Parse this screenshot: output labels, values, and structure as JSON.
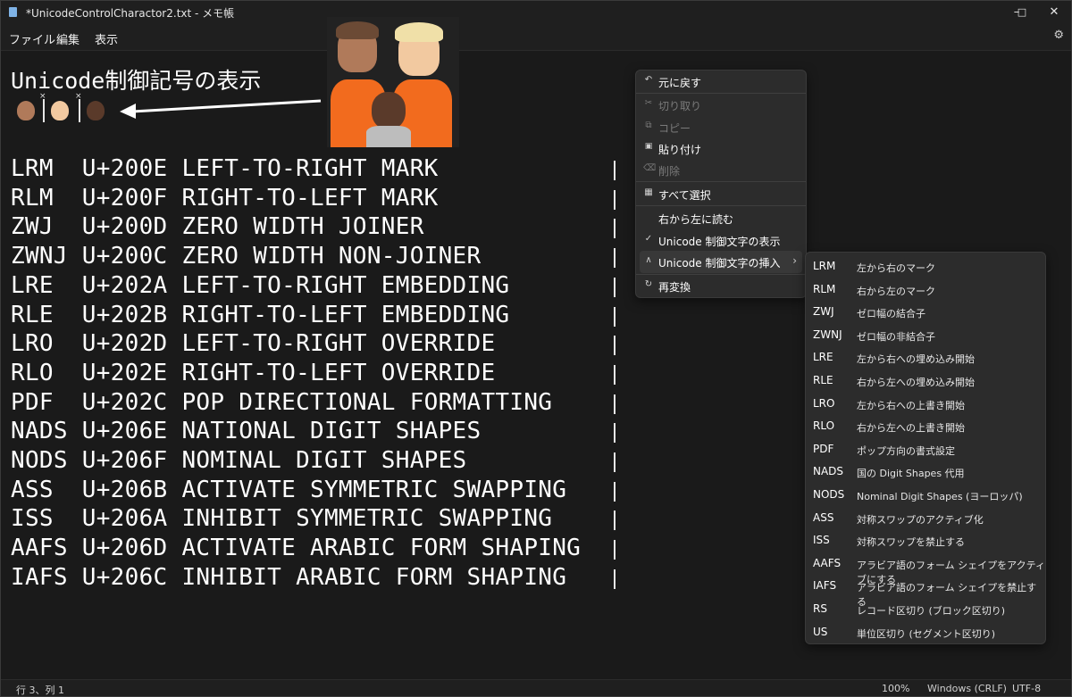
{
  "window": {
    "title": "*UnicodeControlCharactor2.txt - メモ帳",
    "minimize": "–",
    "maximize": "□",
    "close": "✕"
  },
  "menu": {
    "file": "ファイル",
    "edit": "編集",
    "view": "表示"
  },
  "editor": {
    "heading": "Unicode制御記号の表示",
    "lines": [
      "LRM  U+200E LEFT-TO-RIGHT MARK",
      "RLM  U+200F RIGHT-TO-LEFT MARK",
      "ZWJ  U+200D ZERO WIDTH JOINER",
      "ZWNJ U+200C ZERO WIDTH NON-JOINER",
      "LRE  U+202A LEFT-TO-RIGHT EMBEDDING",
      "RLE  U+202B RIGHT-TO-LEFT EMBEDDING",
      "LRO  U+202D LEFT-TO-RIGHT OVERRIDE",
      "RLO  U+202E RIGHT-TO-LEFT OVERRIDE",
      "PDF  U+202C POP DIRECTIONAL FORMATTING",
      "NADS U+206E NATIONAL DIGIT SHAPES",
      "NODS U+206F NOMINAL DIGIT SHAPES",
      "ASS  U+206B ACTIVATE SYMMETRIC SWAPPING",
      "ISS  U+206A INHIBIT SYMMETRIC SWAPPING",
      "AAFS U+206D ACTIVATE ARABIC FORM SHAPING",
      "IAFS U+206C INHIBIT ARABIC FORM SHAPING"
    ]
  },
  "context_menu": {
    "items": [
      {
        "icon": "↶",
        "label": "元に戻す"
      },
      {
        "icon": "✂",
        "label": "切り取り"
      },
      {
        "icon": "⧉",
        "label": "コピー"
      },
      {
        "icon": "📋",
        "label": "貼り付け"
      },
      {
        "icon": "🗑",
        "label": "削除"
      },
      {
        "icon": "▦",
        "label": "すべて選択"
      },
      {
        "icon": "",
        "label": "右から左に読む"
      },
      {
        "icon": "✓",
        "label": "Unicode 制御文字の表示"
      },
      {
        "icon": "∧",
        "label": "Unicode 制御文字の挿入",
        "chevron": "›"
      },
      {
        "icon": "↻",
        "label": "再変換"
      }
    ]
  },
  "submenu": {
    "items": [
      {
        "abbr": "LRM",
        "desc": "左から右のマーク"
      },
      {
        "abbr": "RLM",
        "desc": "右から左のマーク"
      },
      {
        "abbr": "ZWJ",
        "desc": "ゼロ幅の結合子"
      },
      {
        "abbr": "ZWNJ",
        "desc": "ゼロ幅の非結合子"
      },
      {
        "abbr": "LRE",
        "desc": "左から右への埋め込み開始"
      },
      {
        "abbr": "RLE",
        "desc": "右から左への埋め込み開始"
      },
      {
        "abbr": "LRO",
        "desc": "左から右への上書き開始"
      },
      {
        "abbr": "RLO",
        "desc": "右から左への上書き開始"
      },
      {
        "abbr": "PDF",
        "desc": "ポップ方向の書式設定"
      },
      {
        "abbr": "NADS",
        "desc": "国の Digit Shapes 代用"
      },
      {
        "abbr": "NODS",
        "desc": "Nominal Digit Shapes (ヨーロッパ)"
      },
      {
        "abbr": "ASS",
        "desc": "対称スワップのアクティブ化"
      },
      {
        "abbr": "ISS",
        "desc": "対称スワップを禁止する"
      },
      {
        "abbr": "AAFS",
        "desc": "アラビア語のフォーム シェイプをアクティブにする"
      },
      {
        "abbr": "IAFS",
        "desc": "アラビア語のフォーム シェイプを禁止する"
      },
      {
        "abbr": "RS",
        "desc": "レコード区切り (ブロック区切り)"
      },
      {
        "abbr": "US",
        "desc": "単位区切り (セグメント区切り)"
      }
    ]
  },
  "status": {
    "position": "行 3、列 1",
    "zoom": "100%",
    "line_ending": "Windows (CRLF)",
    "encoding": "UTF-8"
  }
}
